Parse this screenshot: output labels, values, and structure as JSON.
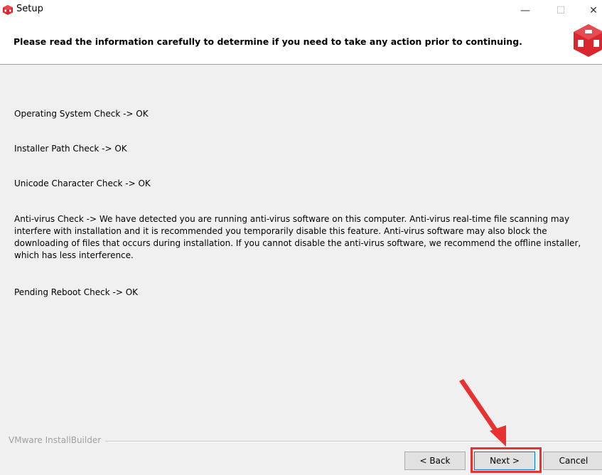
{
  "window": {
    "title": "Setup",
    "minimize_glyph": "—",
    "maximize_glyph": "☐",
    "close_glyph": "✕"
  },
  "header": {
    "text": "Please read the information carefully to determine if you need to take any action prior to continuing."
  },
  "checks": [
    "Operating System Check -> OK",
    "Installer Path Check -> OK",
    "Unicode Character Check ->  OK",
    "Anti-virus Check -> We have detected you are running anti-virus software on this computer. Anti-virus real-time file scanning may interfere with installation and it is recommended you temporarily disable this feature. Anti-virus software may also block the downloading of files that occurs during installation. If you cannot disable the anti-virus software, we recommend the offline installer, which has less interference.",
    "Pending Reboot Check -> OK"
  ],
  "footer": {
    "brand": "VMware InstallBuilder",
    "back_label": "< Back",
    "next_label": "Next >",
    "cancel_label": "Cancel"
  },
  "icons": {
    "app": "installbuilder-cube-icon",
    "logo": "installbuilder-cube-logo"
  },
  "colors": {
    "accent_red": "#e83232",
    "logo_red": "#d9262f",
    "focus_blue": "#0078d7"
  }
}
